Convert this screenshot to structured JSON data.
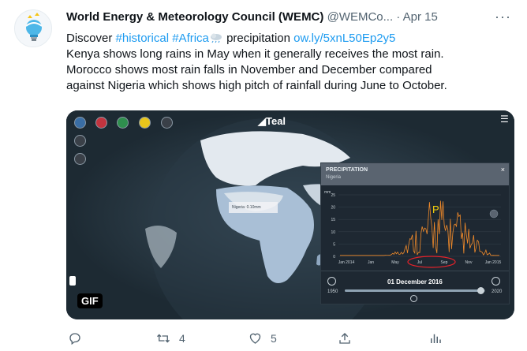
{
  "tweet": {
    "author_name": "World Energy & Meteorology Council (WEMC)",
    "handle": "@WEMCo...",
    "separator": " · ",
    "date": "Apr 15",
    "more_icon": "ellipsis-icon",
    "line1": {
      "prefix": "Discover ",
      "hashtag1": "#historical",
      "hashtag2": "#Africa",
      "suffix": " precipitation ",
      "link": "ow.ly/5xnL50Ep2y5"
    },
    "line2": "Kenya shows long rains in May when it generally receives the most rain.",
    "line3": "Morocco shows  most rain falls in November and December compared",
    "line4": "against Nigeria which shows high pitch of rainfall during June to October."
  },
  "media": {
    "gif_label": "GIF",
    "app_logo": "Teal",
    "map_tooltip": "Nigeria: 0.10mm",
    "panel": {
      "title": "PRECIPITATION",
      "subtitle": "Nigeria",
      "y_unit": "mm",
      "y_ticks": [
        "25",
        "20",
        "15",
        "10",
        "5",
        "0"
      ],
      "x_ticks": [
        "Jan 2014",
        "Jan",
        "May",
        "Jul",
        "Sep",
        "Nov",
        "Jan 2015"
      ],
      "annotation": "P",
      "date": "01 December 2016",
      "year_start": "1950",
      "year_end": "2020",
      "close_glyph": "×"
    },
    "colors": {
      "sea": "#1d2a33",
      "land": "#e3e9ef",
      "africa": "#a9bfd6",
      "chart_line": "#f08a2a",
      "annotation": "#f5d20a",
      "highlight": "#e8222a"
    }
  },
  "actions": {
    "reply_icon": "reply-icon",
    "retweet_icon": "retweet-icon",
    "retweet_count": "4",
    "like_icon": "heart-icon",
    "like_count": "5",
    "share_icon": "share-icon",
    "analytics_icon": "analytics-icon"
  }
}
